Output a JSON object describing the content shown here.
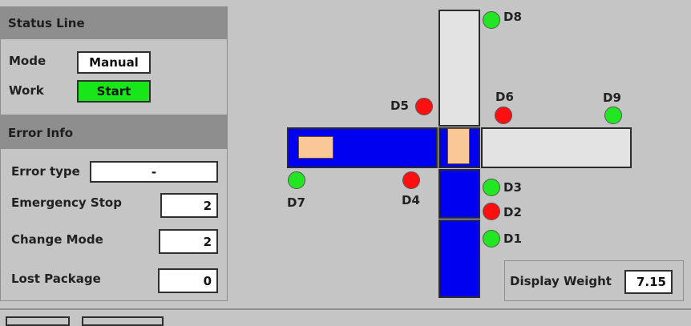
{
  "status": {
    "title": "Status Line",
    "mode_label": "Mode",
    "mode_value": "Manual",
    "work_label": "Work",
    "work_value": "Start"
  },
  "errors": {
    "title": "Error Info",
    "type_label": "Error type",
    "type_value": "-",
    "emergency_label": "Emergency Stop",
    "emergency_value": "2",
    "change_label": "Change Mode",
    "change_value": "2",
    "lost_label": "Lost Package",
    "lost_value": "0"
  },
  "sensors": {
    "d1": {
      "label": "D1",
      "state": "on"
    },
    "d2": {
      "label": "D2",
      "state": "off"
    },
    "d3": {
      "label": "D3",
      "state": "on"
    },
    "d4": {
      "label": "D4",
      "state": "off"
    },
    "d5": {
      "label": "D5",
      "state": "off"
    },
    "d6": {
      "label": "D6",
      "state": "off"
    },
    "d7": {
      "label": "D7",
      "state": "on"
    },
    "d8": {
      "label": "D8",
      "state": "on"
    },
    "d9": {
      "label": "D9",
      "state": "on"
    }
  },
  "weight": {
    "label": "Display Weight",
    "value": "7.15"
  },
  "colors": {
    "belt_active": "#0000f0",
    "belt_idle": "#e3e3e3",
    "sensor_on": "#22e622",
    "sensor_off": "#ff1010",
    "start_button": "#19e619",
    "package": "#f9c896"
  }
}
